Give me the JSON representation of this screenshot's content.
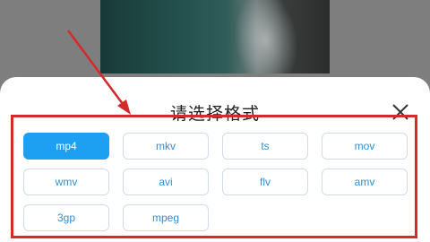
{
  "dialog": {
    "title": "请选择格式",
    "close_icon": "close-icon"
  },
  "formats": {
    "selected": "mp4",
    "items": [
      {
        "label": "mp4"
      },
      {
        "label": "mkv"
      },
      {
        "label": "ts"
      },
      {
        "label": "mov"
      },
      {
        "label": "wmv"
      },
      {
        "label": "avi"
      },
      {
        "label": "flv"
      },
      {
        "label": "amv"
      },
      {
        "label": "3gp"
      },
      {
        "label": "mpeg"
      }
    ]
  },
  "colors": {
    "accent": "#1ea0f2",
    "button_text": "#2f8fd2",
    "annotation": "#d42a2a"
  }
}
